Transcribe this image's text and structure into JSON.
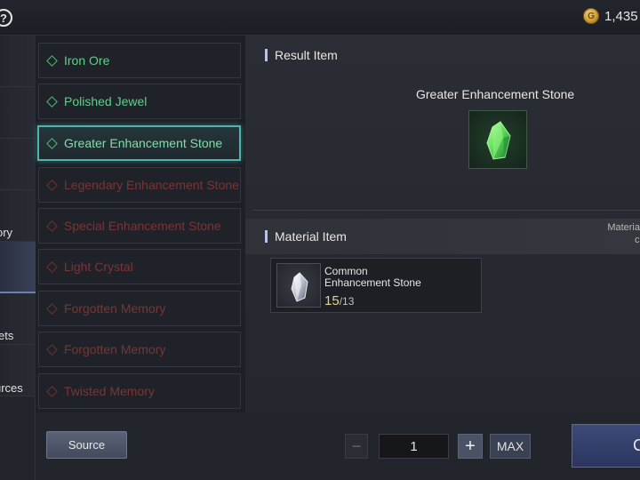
{
  "header": {
    "currency_amount": "1,435"
  },
  "nav": {
    "tabs": [
      {
        "label": ""
      },
      {
        "label": ""
      },
      {
        "label": ""
      },
      {
        "label": "ory"
      },
      {
        "label": ""
      },
      {
        "label": "ets"
      },
      {
        "label": "urces"
      }
    ]
  },
  "recipes": [
    {
      "label": "Iron Ore",
      "state": "available"
    },
    {
      "label": "Polished Jewel",
      "state": "available"
    },
    {
      "label": "Greater Enhancement Stone",
      "state": "selected"
    },
    {
      "label": "Legendary Enhancement Stone",
      "state": "locked"
    },
    {
      "label": "Special Enhancement Stone",
      "state": "locked"
    },
    {
      "label": "Light Crystal",
      "state": "locked"
    },
    {
      "label": "Forgotten Memory",
      "state": "locked"
    },
    {
      "label": "Forgotten Memory",
      "state": "locked"
    },
    {
      "label": "Twisted Memory",
      "state": "locked"
    }
  ],
  "result": {
    "section_title": "Result Item",
    "item_name": "Greater Enhancement Stone"
  },
  "material": {
    "section_title": "Material Item",
    "note_line1": "Materia",
    "note_line2": "c",
    "item_name_line1": "Common",
    "item_name_line2": "Enhancement Stone",
    "owned": "15",
    "required": "/13"
  },
  "bottom": {
    "source_label": "Source",
    "minus_label": "−",
    "quantity": "1",
    "plus_label": "+",
    "max_label": "MAX",
    "craft_label": "C"
  },
  "colors": {
    "available": "#5fd08a",
    "locked": "#7a3535",
    "selected_border": "#4fb3b0",
    "accent": "#b7c4e8"
  }
}
